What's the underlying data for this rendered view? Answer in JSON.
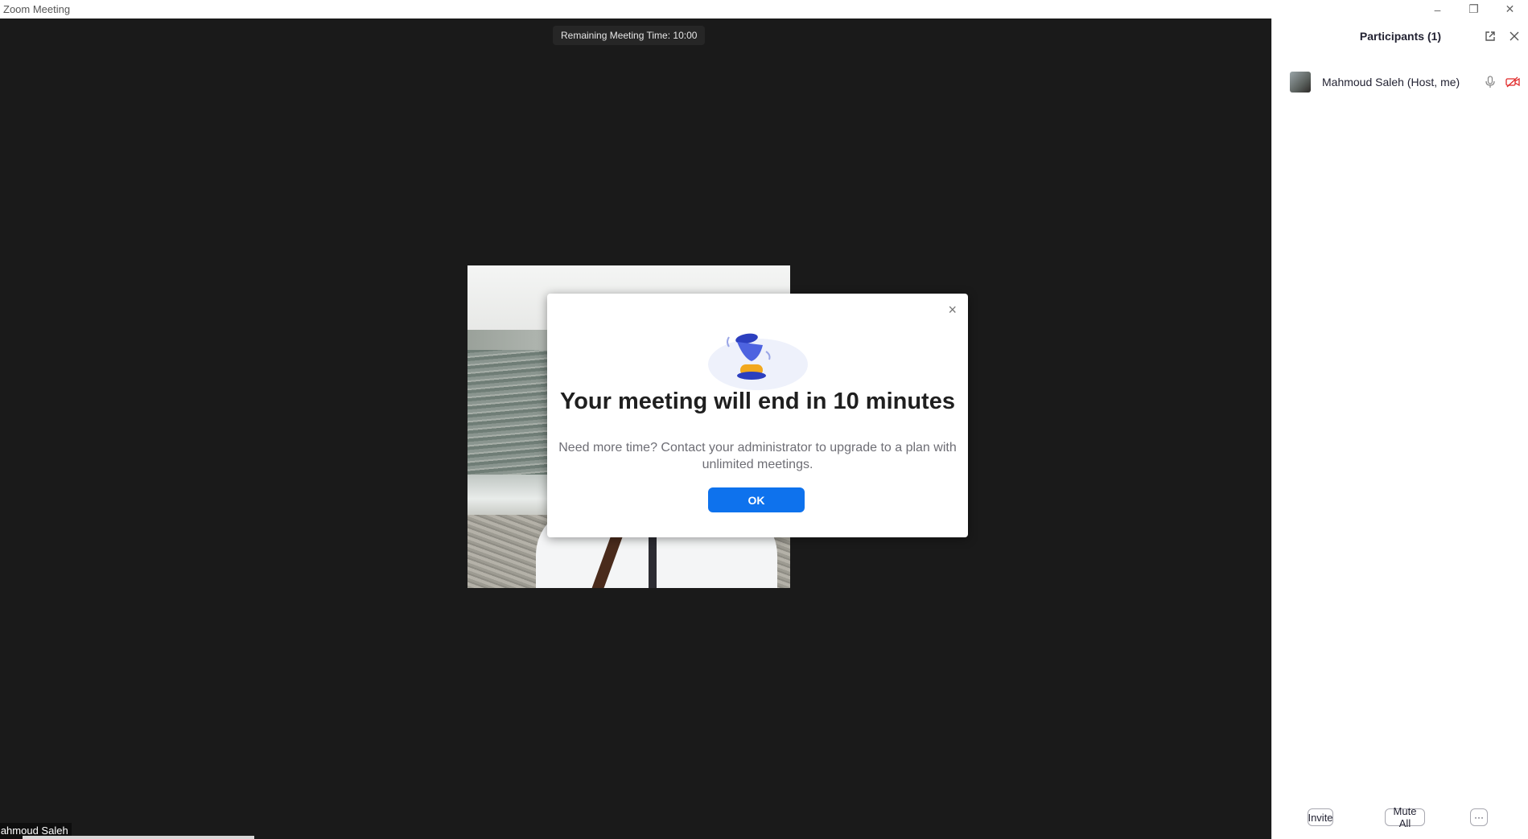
{
  "window": {
    "title": "Zoom Meeting",
    "controls": {
      "minimize": "–",
      "restore": "❐",
      "close": "✕"
    }
  },
  "stage": {
    "remaining_time": "Remaining Meeting Time: 10:00",
    "self_name": "Mahmoud Saleh"
  },
  "dialog": {
    "close_symbol": "×",
    "heading": "Your meeting will end in 10 minutes",
    "message": "Need more time? Contact your administrator to upgrade to a plan with unlimited meetings.",
    "ok_label": "OK"
  },
  "participants": {
    "title": "Participants (1)",
    "list": [
      {
        "name": "Mahmoud Saleh (Host, me)",
        "mic": "mic-icon",
        "video": "video-off-icon"
      }
    ],
    "footer": {
      "invite_label": "Invite",
      "mute_all_label": "Mute All",
      "more_label": "···"
    }
  },
  "colors": {
    "accent": "#0e72ed",
    "stage_bg": "#1a1a1a",
    "video_off_red": "#e02828"
  }
}
